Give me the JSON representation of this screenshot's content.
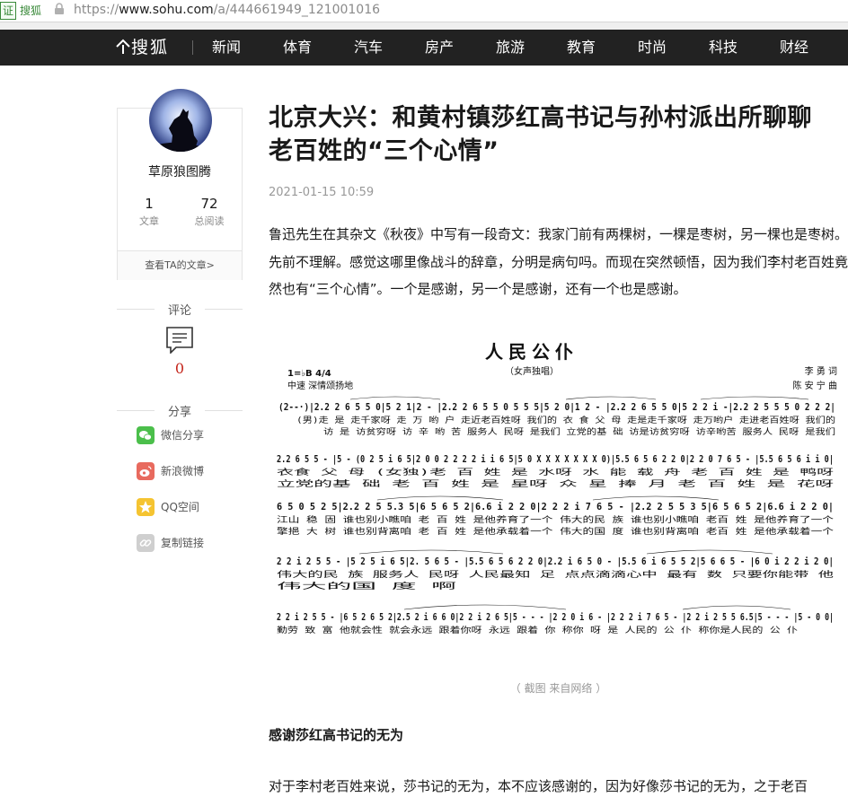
{
  "browser": {
    "cert_label": "证",
    "site_name": "搜狐",
    "url_prefix": "https://",
    "url_host": "www.sohu.com",
    "url_path": "/a/444661949_121001016"
  },
  "nav": {
    "logo": "搜狐",
    "items": [
      "新闻",
      "体育",
      "汽车",
      "房产",
      "旅游",
      "教育",
      "时尚",
      "科技",
      "财经"
    ]
  },
  "author": {
    "name": "草原狼图腾",
    "articles_count": "1",
    "articles_label": "文章",
    "reads_count": "72",
    "reads_label": "总阅读",
    "link_label": "查看TA的文章>"
  },
  "comment": {
    "title": "评论",
    "count": "0"
  },
  "share": {
    "title": "分享",
    "items": [
      "微信分享",
      "新浪微博",
      "QQ空间",
      "复制链接"
    ],
    "colors": [
      "#4bbf4b",
      "#e86a5e",
      "#f5c431",
      "#cfcfcf"
    ]
  },
  "article": {
    "title": "北京大兴：和黄村镇莎红高书记与孙村派出所聊聊老百姓的“三个心情”",
    "date": "2021-01-15 10:59",
    "paragraph": "鲁迅先生在其杂文《秋夜》中写有一段奇文：我家门前有两棵树，一棵是枣树，另一棵也是枣树。先前不理解。感觉这哪里像战斗的辞章，分明是病句吗。而现在突然顿悟，因为我们李村老百姓竟然也有“三个心情”。一个是感谢，另一个是感谢，还有一个也是感谢。",
    "caption": "（ 截图 来自网络 ）",
    "subheading": "感谢莎红高书记的无为",
    "cut_paragraph": "对于李村老百姓来说，莎书记的无为，本不应该感谢的，因为好像莎书记的无为，之于老百"
  },
  "score": {
    "title": "人民公仆",
    "subtitle": "（女声独唱）",
    "key": "1=♭B 4/4",
    "tempo": "中速 深情颂扬地",
    "lyricist": "李   勇 词",
    "composer": "陈 安 宁 曲"
  }
}
